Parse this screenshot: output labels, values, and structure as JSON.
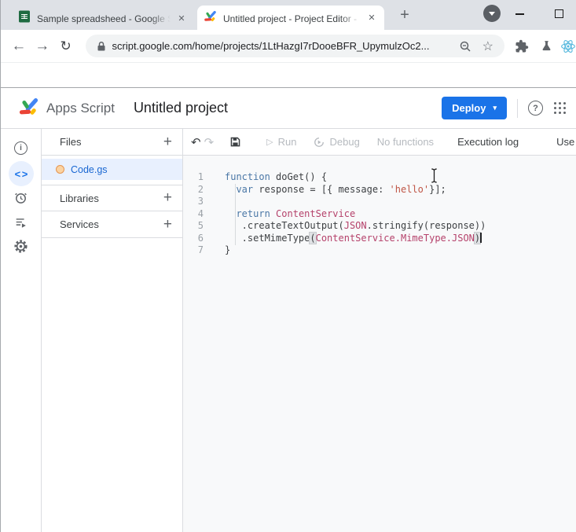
{
  "browser": {
    "tabs": [
      {
        "title": "Sample spreadsheed - Google Sh",
        "icon": "google-sheets"
      },
      {
        "title": "Untitled project - Project Editor -",
        "icon": "apps-script"
      }
    ],
    "close_glyph": "✕",
    "new_tab_glyph": "+",
    "back_glyph": "←",
    "forward_glyph": "→",
    "reload_glyph": "↻",
    "star_glyph": "☆",
    "url": "script.google.com/home/projects/1LtHazgI7rDooeBFR_UpymulzOc2..."
  },
  "header": {
    "brand": "Apps Script",
    "title": "Untitled project",
    "deploy_label": "Deploy",
    "deploy_caret": "▾",
    "help_glyph": "?"
  },
  "nav_rail": {
    "info_glyph": "i",
    "editor_glyph": "< >"
  },
  "files_panel": {
    "files_label": "Files",
    "add_glyph": "+",
    "file_name": "Code.gs",
    "libraries_label": "Libraries",
    "services_label": "Services"
  },
  "editor_toolbar": {
    "undo_glyph": "↶",
    "redo_glyph": "↷",
    "run_glyph": "▷",
    "run_label": "Run",
    "debug_label": "Debug",
    "functions_label": "No functions",
    "execution_log_label": "Execution log",
    "legacy_label": "Use legacy editor"
  },
  "editor": {
    "caret_line": 6,
    "lines": [
      [
        {
          "t": "function",
          "c": "k"
        },
        {
          "t": " doGet() {",
          "c": "p"
        }
      ],
      [
        {
          "t": "  ",
          "c": "p"
        },
        {
          "t": "var",
          "c": "k"
        },
        {
          "t": " response = [{ message: ",
          "c": "p"
        },
        {
          "t": "'hello'",
          "c": "s"
        },
        {
          "t": "}];",
          "c": "p"
        }
      ],
      [],
      [
        {
          "t": "  ",
          "c": "p"
        },
        {
          "t": "return",
          "c": "k"
        },
        {
          "t": " ",
          "c": "p"
        },
        {
          "t": "ContentService",
          "c": "r"
        }
      ],
      [
        {
          "t": "   .createTextOutput(",
          "c": "p"
        },
        {
          "t": "JSON",
          "c": "r"
        },
        {
          "t": ".stringify(response))",
          "c": "p"
        }
      ],
      [
        {
          "t": "   .setMimeType",
          "c": "p"
        },
        {
          "t": "(",
          "c": "b"
        },
        {
          "t": "ContentService.MimeType.JSON",
          "c": "r"
        },
        {
          "t": ")",
          "c": "b"
        }
      ],
      [
        {
          "t": "}",
          "c": "p"
        }
      ]
    ]
  },
  "colors": {
    "accent_blue": "#1a73e8",
    "selected_file_bg": "#e8f0fe",
    "selected_file_text": "#1967d2",
    "editor_bg": "#f8f9fa",
    "keyword": "#4a77a6",
    "string": "#bf5545",
    "identifier_red": "#b5426b",
    "tabstrip_bg": "#dee1e6"
  }
}
